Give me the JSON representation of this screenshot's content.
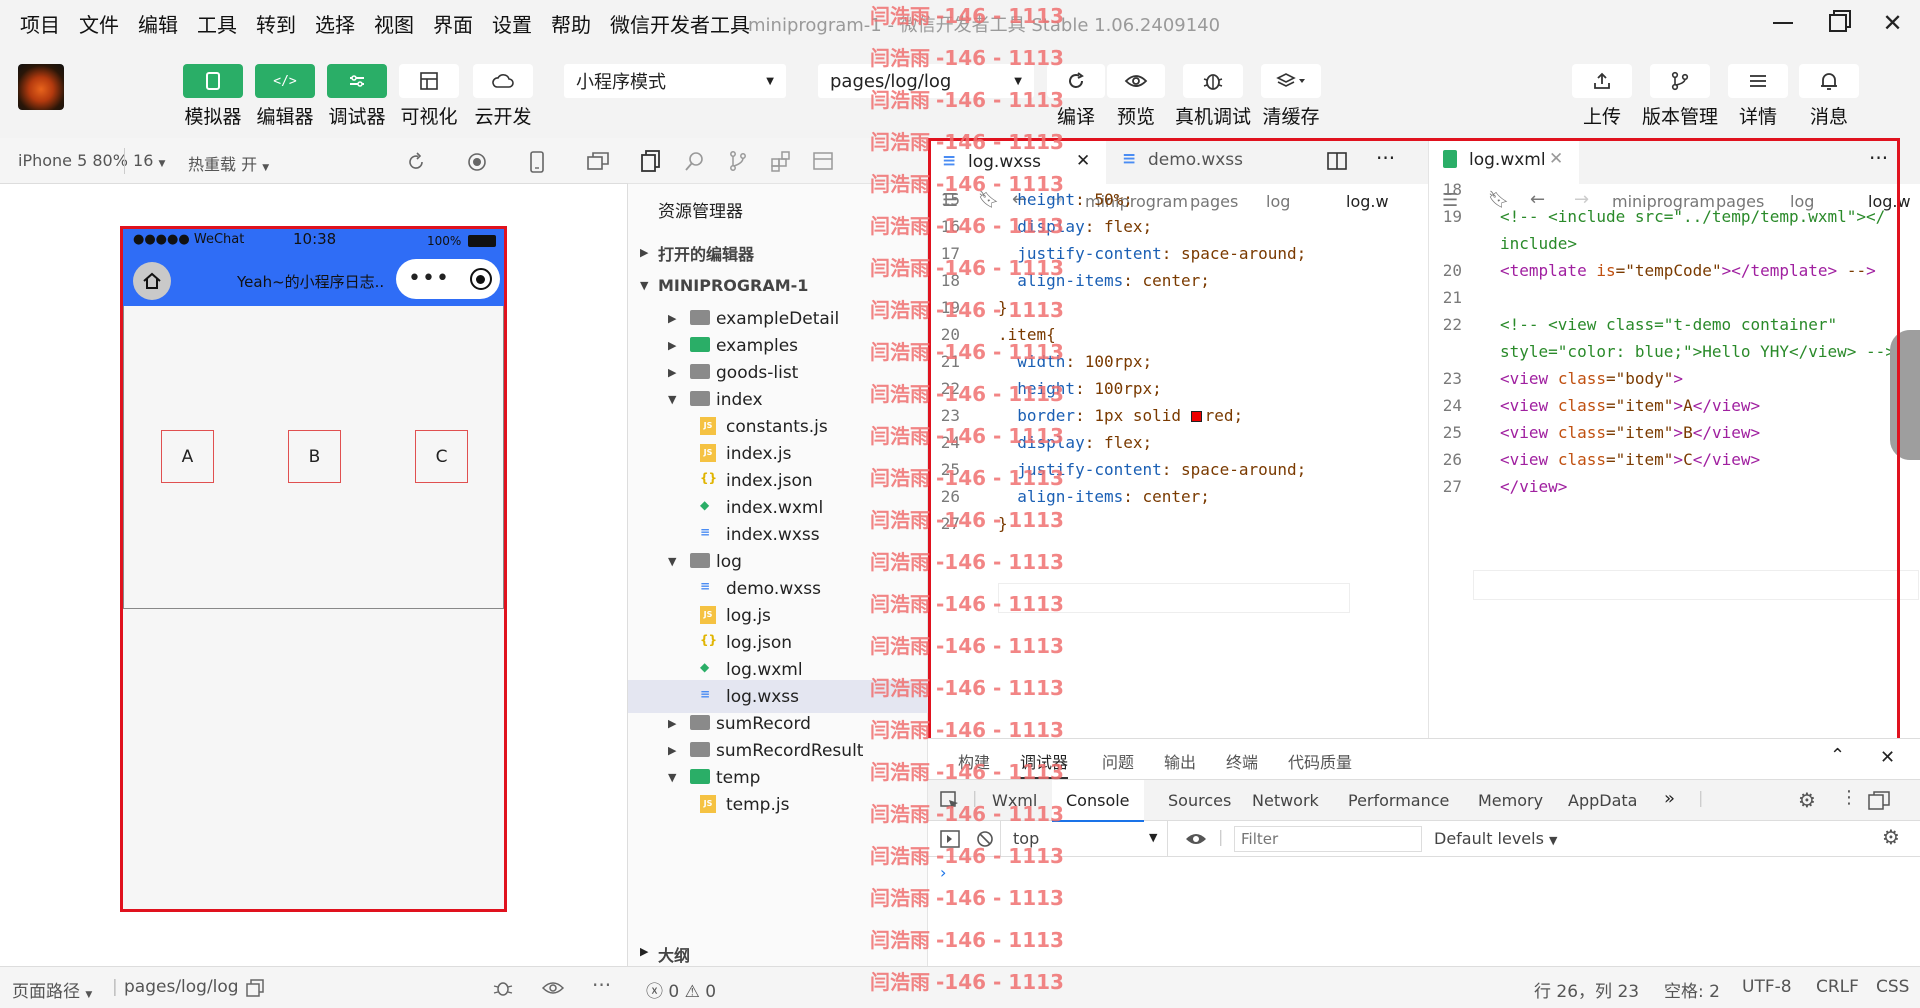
{
  "menu": [
    "项目",
    "文件",
    "编辑",
    "工具",
    "转到",
    "选择",
    "视图",
    "界面",
    "设置",
    "帮助",
    "微信开发者工具"
  ],
  "window_title": "miniprogram-1 - 微信开发者工具 Stable 1.06.2409140",
  "toolbar": {
    "simulator": "模拟器",
    "editor": "编辑器",
    "debugger": "调试器",
    "visual": "可视化",
    "cloud": "云开发",
    "mode_select": "小程序模式",
    "page_select": "pages/log/log",
    "compile": "编译",
    "preview": "预览",
    "real_debug": "真机调试",
    "clear_cache": "清缓存",
    "upload": "上传",
    "version": "版本管理",
    "details": "详情",
    "messages": "消息"
  },
  "sim": {
    "device": "iPhone 5 80% 16",
    "hot_reload": "热重载 开",
    "phone": {
      "carrier": "●●●●● WeChat",
      "time": "10:38",
      "battery": "100%",
      "nav_title": "Yeah~的小程序日志...",
      "items": [
        "A",
        "B",
        "C"
      ]
    },
    "path_label": "页面路径",
    "path": "pages/log/log"
  },
  "explorer": {
    "title": "资源管理器",
    "open_editors": "打开的编辑器",
    "project": "MINIPROGRAM-1",
    "tree": [
      {
        "name": "exampleDetail",
        "type": "folder",
        "depth": 1,
        "open": false
      },
      {
        "name": "examples",
        "type": "folder-special",
        "depth": 1,
        "open": false
      },
      {
        "name": "goods-list",
        "type": "folder",
        "depth": 1,
        "open": false
      },
      {
        "name": "index",
        "type": "folder",
        "depth": 1,
        "open": true
      },
      {
        "name": "constants.js",
        "type": "js",
        "depth": 2
      },
      {
        "name": "index.js",
        "type": "js",
        "depth": 2
      },
      {
        "name": "index.json",
        "type": "json",
        "depth": 2
      },
      {
        "name": "index.wxml",
        "type": "wxml",
        "depth": 2
      },
      {
        "name": "index.wxss",
        "type": "wxss",
        "depth": 2
      },
      {
        "name": "log",
        "type": "folder",
        "depth": 1,
        "open": true
      },
      {
        "name": "demo.wxss",
        "type": "wxss",
        "depth": 2
      },
      {
        "name": "log.js",
        "type": "js",
        "depth": 2
      },
      {
        "name": "log.json",
        "type": "json",
        "depth": 2
      },
      {
        "name": "log.wxml",
        "type": "wxml",
        "depth": 2
      },
      {
        "name": "log.wxss",
        "type": "wxss",
        "depth": 2,
        "selected": true
      },
      {
        "name": "sumRecord",
        "type": "folder",
        "depth": 1,
        "open": false
      },
      {
        "name": "sumRecordResult",
        "type": "folder",
        "depth": 1,
        "open": false
      },
      {
        "name": "temp",
        "type": "folder-special",
        "depth": 1,
        "open": true
      },
      {
        "name": "temp.js",
        "type": "js",
        "depth": 2
      }
    ],
    "outline": "大纲",
    "problems_count": "0",
    "warnings_count": "0"
  },
  "editor_left": {
    "tabs": [
      "log.wxss",
      "demo.wxss"
    ],
    "breadcrumb": [
      "miniprogram",
      "pages",
      "log",
      "log.w"
    ],
    "lines": [
      {
        "n": "15",
        "code": "  height: 50%;"
      },
      {
        "n": "16",
        "code": "  display: flex;"
      },
      {
        "n": "17",
        "code": "  justify-content: space-around;"
      },
      {
        "n": "18",
        "code": "  align-items: center;"
      },
      {
        "n": "19",
        "code": "}"
      },
      {
        "n": "20",
        "code": ".item{"
      },
      {
        "n": "21",
        "code": "  width: 100rpx;"
      },
      {
        "n": "22",
        "code": "  height: 100rpx;"
      },
      {
        "n": "23",
        "code": "  border: 1px solid ▇red;"
      },
      {
        "n": "24",
        "code": "  display: flex;"
      },
      {
        "n": "25",
        "code": "  justify-content: space-around;"
      },
      {
        "n": "26",
        "code": "  align-items: center;"
      },
      {
        "n": "27",
        "code": "}"
      }
    ]
  },
  "editor_right": {
    "tab": "log.wxml",
    "breadcrumb": [
      "miniprogram",
      "pages",
      "log",
      "log.w"
    ],
    "lines": [
      {
        "n": "18",
        "code": ""
      },
      {
        "n": "19",
        "code": "<!-- <include src=\"../temp/temp.wxml\"></"
      },
      {
        "n": "",
        "code": "include>"
      },
      {
        "n": "20",
        "code": "<template is=\"tempCode\"></template> -->"
      },
      {
        "n": "21",
        "code": ""
      },
      {
        "n": "22",
        "code": "<!-- <view class=\"t-demo container\""
      },
      {
        "n": "",
        "code": "style=\"color: blue;\">Hello YHY</view> -->"
      },
      {
        "n": "23",
        "code": "<view class=\"body\">"
      },
      {
        "n": "24",
        "code": "<view class=\"item\">A</view>"
      },
      {
        "n": "25",
        "code": "<view class=\"item\">B</view>"
      },
      {
        "n": "26",
        "code": "<view class=\"item\">C</view>"
      },
      {
        "n": "27",
        "code": "</view>"
      }
    ]
  },
  "devtools": {
    "top_tabs": [
      "构建",
      "调试器",
      "问题",
      "输出",
      "终端",
      "代码质量"
    ],
    "panels": [
      "Wxml",
      "Console",
      "Sources",
      "Network",
      "Performance",
      "Memory",
      "AppData"
    ],
    "context": "top",
    "filter_placeholder": "Filter",
    "levels": "Default levels"
  },
  "status": {
    "position": "行 26，列 23",
    "spaces": "空格: 2",
    "encoding": "UTF-8",
    "eol": "CRLF",
    "lang": "CSS"
  },
  "watermark": {
    "name": "闫浩雨",
    "code": "-146 - 1113"
  },
  "colors": {
    "green": "#2aae67",
    "red": "#e0121e",
    "nav_blue": "#2f6df6"
  }
}
